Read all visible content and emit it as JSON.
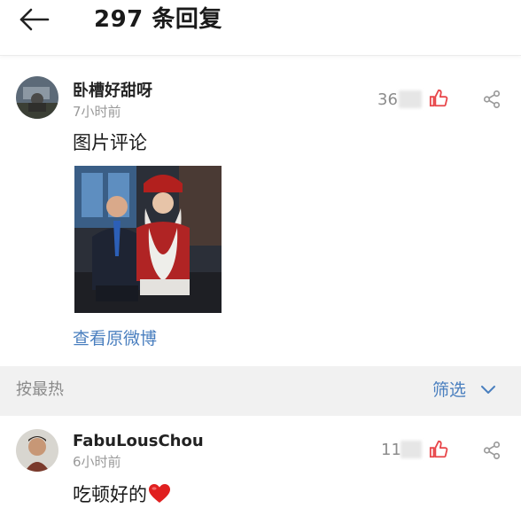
{
  "header": {
    "reply_count_title": "297 条回复"
  },
  "main_comment": {
    "username": "卧槽好甜呀",
    "time": "7小时前",
    "likes": "36",
    "text": "图片评论",
    "view_link": "查看原微博"
  },
  "sort_bar": {
    "sort_label": "按最热",
    "filter_label": "筛选"
  },
  "reply": {
    "username": "FabuLousChou",
    "time": "6小时前",
    "likes": "11",
    "text": "吃顿好的"
  },
  "colors": {
    "accent_blue": "#4a7fbf",
    "like_red": "#e8474b",
    "heart_red": "#e02020",
    "sort_bg": "#f1f1f1"
  },
  "icons": [
    "back-arrow-icon",
    "thumbs-up-icon",
    "share-icon",
    "chevron-down-icon",
    "heart-emoji-icon"
  ]
}
